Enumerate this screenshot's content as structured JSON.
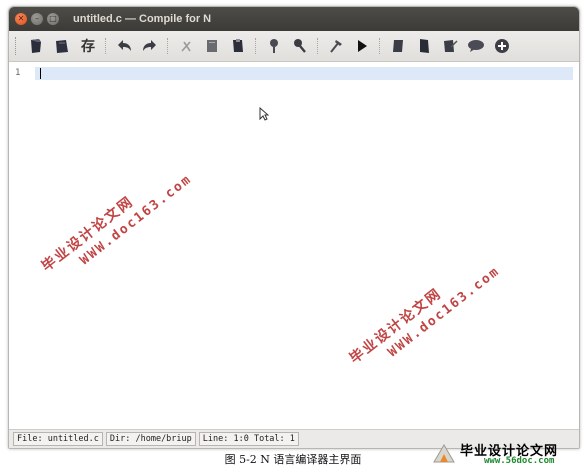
{
  "window": {
    "title": "untitled.c — Compile for N",
    "controls": [
      "close-icon",
      "minimize-icon",
      "maximize-icon"
    ]
  },
  "toolbar": {
    "save_text_label": "存",
    "buttons": [
      "new-file-icon",
      "open-file-icon",
      "save-text-button",
      "undo-icon",
      "redo-icon",
      "cut-icon",
      "copy-icon",
      "paste-icon",
      "search-icon",
      "replace-icon",
      "build-icon",
      "run-icon",
      "doc-icon",
      "page-icon",
      "edit-icon",
      "comment-icon",
      "help-icon"
    ]
  },
  "editor": {
    "line_numbers": [
      "1"
    ],
    "content": ""
  },
  "statusbar": {
    "file": "File: untitled.c",
    "dir": "Dir: /home/briup",
    "position": "Line: 1:0 Total: 1"
  },
  "watermarks": [
    {
      "cn": "毕业设计论文网",
      "url": "WWW.doc163.com"
    },
    {
      "cn": "毕业设计论文网",
      "url": "WWW.doc163.com"
    }
  ],
  "caption": "图 5-2 N 语言编译器主界面",
  "logo": {
    "cn": "毕业设计论文网",
    "url": "www.56doc.com"
  },
  "colors": {
    "titlebar": "#3c3b37",
    "close_button": "#df4a16",
    "current_line": "#dde9f8",
    "watermark": "#b01010",
    "logo_url": "#1c8a2e"
  }
}
